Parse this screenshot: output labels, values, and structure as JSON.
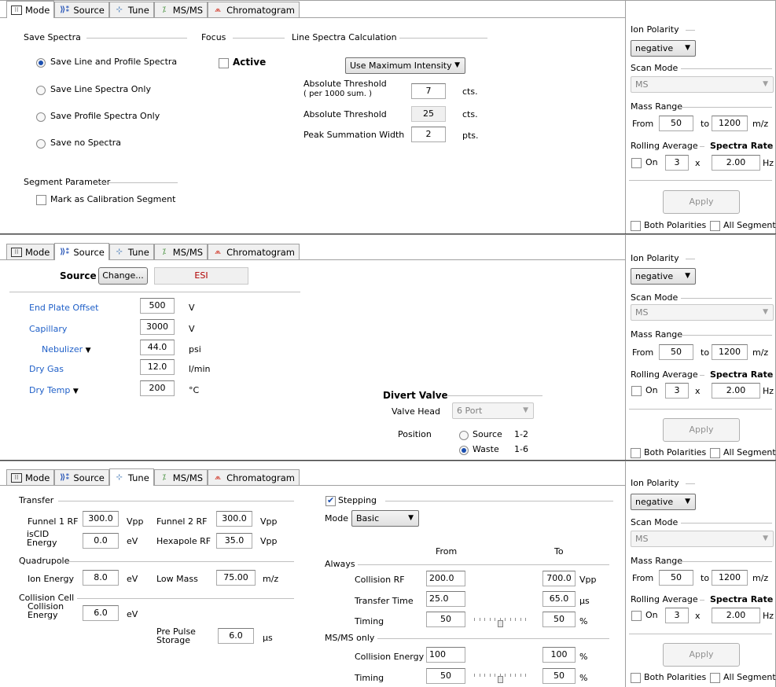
{
  "tabs": {
    "mode": "Mode",
    "source": "Source",
    "tune": "Tune",
    "msms": "MS/MS",
    "chromatogram": "Chromatogram"
  },
  "side": {
    "ion_polarity_label": "Ion Polarity",
    "ion_polarity_value": "negative",
    "scan_mode_label": "Scan Mode",
    "scan_mode_value": "MS",
    "mass_range_label": "Mass Range",
    "from_label": "From",
    "from_value": "50",
    "to_label": "to",
    "to_value": "1200",
    "unit_mz": "m/z",
    "rolling_avg_label": "Rolling Average",
    "spectra_rate_label": "Spectra Rate",
    "on_label": "On",
    "rolling_value": "3",
    "x_label": "x",
    "rate_value": "2.00",
    "hz_label": "Hz",
    "apply_label": "Apply",
    "both_polarities": "Both Polarities",
    "all_segments": "All Segments"
  },
  "mode": {
    "save_spectra_label": "Save Spectra",
    "opt1": "Save Line and Profile Spectra",
    "opt2": "Save Line Spectra Only",
    "opt3": "Save Profile Spectra Only",
    "opt4": "Save no Spectra",
    "focus_label": "Focus",
    "active_label": "Active",
    "line_calc_label": "Line Spectra Calculation",
    "calc_method": "Use Maximum Intensity",
    "abs_thr_per_label_1": "Absolute Threshold",
    "abs_thr_per_label_2": "( per 1000 sum. )",
    "abs_thr_per_value": "7",
    "cts": "cts.",
    "abs_thr_label": "Absolute Threshold",
    "abs_thr_value": "25",
    "peak_width_label": "Peak Summation Width",
    "peak_width_value": "2",
    "pts": "pts.",
    "segment_label": "Segment Parameter",
    "mark_calib_label": "Mark as Calibration Segment"
  },
  "source": {
    "source_label": "Source",
    "change_label": "Change...",
    "source_value": "ESI",
    "end_plate_label": "End Plate Offset",
    "end_plate_value": "500",
    "end_plate_unit": "V",
    "capillary_label": "Capillary",
    "capillary_value": "3000",
    "capillary_unit": "V",
    "nebulizer_label": "Nebulizer",
    "nebulizer_value": "44.0",
    "nebulizer_unit": "psi",
    "dry_gas_label": "Dry Gas",
    "dry_gas_value": "12.0",
    "dry_gas_unit": "l/min",
    "dry_temp_label": "Dry Temp",
    "dry_temp_value": "200",
    "dry_temp_unit": "°C",
    "divert_label": "Divert Valve",
    "valve_head_label": "Valve Head",
    "valve_head_value": "6 Port",
    "position_label": "Position",
    "source_pos_label": "Source",
    "source_pos_ports": "1-2",
    "waste_pos_label": "Waste",
    "waste_pos_ports": "1-6"
  },
  "tune": {
    "transfer_label": "Transfer",
    "funnel1_label": "Funnel 1 RF",
    "funnel1_value": "300.0",
    "funnel1_unit": "Vpp",
    "funnel2_label": "Funnel 2 RF",
    "funnel2_value": "300.0",
    "funnel2_unit": "Vpp",
    "iscid_label_1": "isCID",
    "iscid_label_2": "Energy",
    "iscid_value": "0.0",
    "iscid_unit": "eV",
    "hexapole_label": "Hexapole RF",
    "hexapole_value": "35.0",
    "hexapole_unit": "Vpp",
    "quadrupole_label": "Quadrupole",
    "ion_energy_label": "Ion Energy",
    "ion_energy_value": "8.0",
    "ion_energy_unit": "eV",
    "low_mass_label": "Low Mass",
    "low_mass_value": "75.00",
    "low_mass_unit": "m/z",
    "collision_cell_label": "Collision Cell",
    "coll_energy_label_1": "Collision",
    "coll_energy_label_2": "Energy",
    "coll_energy_value": "6.0",
    "coll_energy_unit": "eV",
    "pre_pulse_label_1": "Pre Pulse",
    "pre_pulse_label_2": "Storage",
    "pre_pulse_value": "6.0",
    "pre_pulse_unit": "µs",
    "stepping_label": "Stepping",
    "mode_label": "Mode",
    "mode_value": "Basic",
    "from_header": "From",
    "to_header": "To",
    "always_label": "Always",
    "coll_rf_label": "Collision RF",
    "coll_rf_from": "200.0",
    "coll_rf_to": "700.0",
    "coll_rf_unit": "Vpp",
    "transfer_time_label": "Transfer Time",
    "transfer_time_from": "25.0",
    "transfer_time_to": "65.0",
    "transfer_time_unit": "µs",
    "timing_label": "Timing",
    "timing_from": "50",
    "timing_to": "50",
    "timing_unit": "%",
    "timing_slider": 0.5,
    "msms_only_label": "MS/MS only",
    "msms_ce_label": "Collision Energy",
    "msms_ce_from": "100",
    "msms_ce_to": "100",
    "msms_ce_unit": "%",
    "msms_timing_label": "Timing",
    "msms_timing_from": "50",
    "msms_timing_to": "50",
    "msms_timing_unit": "%",
    "msms_timing_slider": 0.5
  }
}
